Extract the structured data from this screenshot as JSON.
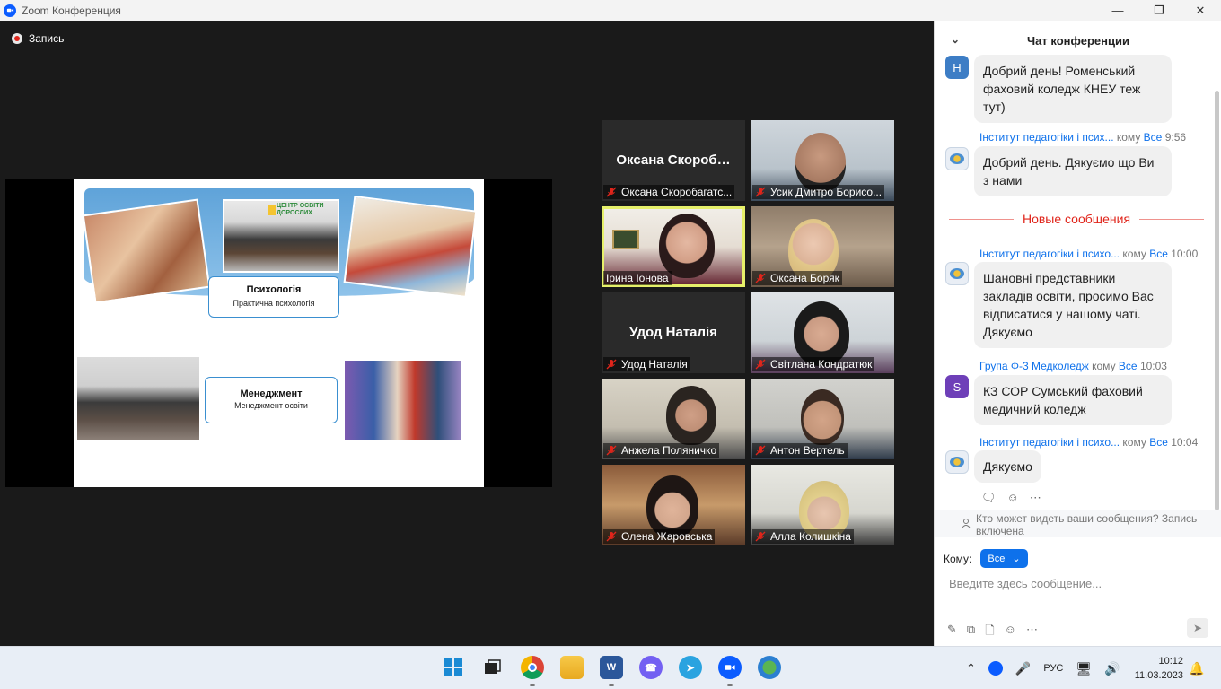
{
  "window": {
    "title": "Zoom Конференция",
    "controls": [
      "—",
      "❐",
      "✕"
    ]
  },
  "meeting": {
    "recording_label": "Запись",
    "slide": {
      "box1_title": "Психологія",
      "box1_subtitle": "Практична психологія",
      "box2_title": "Менеджмент",
      "box2_subtitle": "Менеджмент освіти",
      "banner_sign": "ЦЕНТР ОСВІТИ ДОРОСЛИХ"
    },
    "participants": [
      {
        "name": "Оксана Скоробагатс...",
        "big_name": "Оксана Скороб…",
        "video": false
      },
      {
        "name": "Усик Дмитро Борисо...",
        "video": true
      },
      {
        "name": "Ірина Іонова",
        "video": true,
        "active": true
      },
      {
        "name": "Оксана Боряк",
        "video": true
      },
      {
        "name": "Удод Наталія",
        "big_name": "Удод Наталія",
        "video": false
      },
      {
        "name": "Світлана Кондратюк",
        "video": true
      },
      {
        "name": "Анжела Поляничко",
        "video": true
      },
      {
        "name": "Антон Вертель",
        "video": true
      },
      {
        "name": "Олена Жаровська",
        "video": true
      },
      {
        "name": "Алла Колишкіна",
        "video": true
      }
    ]
  },
  "chat": {
    "title": "Чат конференции",
    "messages": [
      {
        "avatar_letter": "Н",
        "text": "Добрий день! Роменський фаховий коледж КНЕУ теж тут)"
      },
      {
        "from": "Інститут педагогіки і псих...",
        "to_prefix": "кому",
        "to": "Все",
        "time": "9:56",
        "text": "Добрий день. Дякуємо що Ви з нами"
      },
      {
        "from": "Інститут педагогіки і психо...",
        "to_prefix": "кому",
        "to": "Все",
        "time": "10:00",
        "text": "Шановні представники закладів освіти, просимо Вас відписатися у нашому чаті. Дякуємо"
      },
      {
        "avatar_letter": "S",
        "from": "Група Ф-3 Медколедж",
        "to_prefix": "кому",
        "to": "Все",
        "time": "10:03",
        "text": "КЗ СОР Сумський фаховий медичний коледж"
      },
      {
        "from": "Інститут педагогіки і психо...",
        "to_prefix": "кому",
        "to": "Все",
        "time": "10:04",
        "text": "Дякуємо"
      }
    ],
    "new_messages_label": "Новые сообщения",
    "privacy_notice": "Кто может видеть ваши сообщения? Запись включена",
    "to_label": "Кому:",
    "to_value": "Все",
    "input_placeholder": "Введите здесь сообщение..."
  },
  "taskbar": {
    "language": "РУС",
    "time": "10:12",
    "date": "11.03.2023"
  }
}
